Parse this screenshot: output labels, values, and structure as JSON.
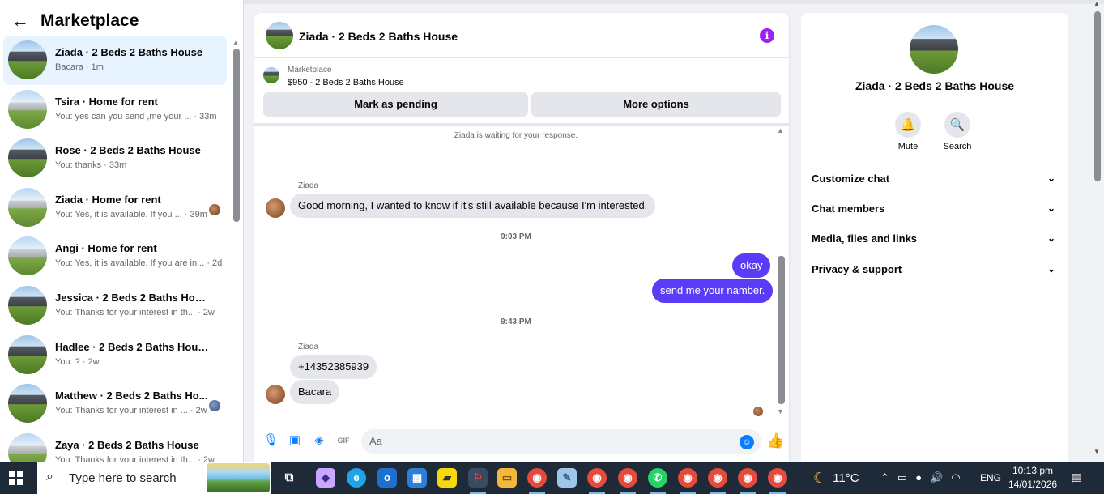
{
  "sidebar": {
    "title": "Marketplace",
    "conversations": [
      {
        "name": "Ziada · 2 Beds 2 Baths House",
        "snippet": "Bacara · 1m"
      },
      {
        "name": "Tsira · Home for rent",
        "snippet": "You: yes can you send ,me your ... · 33m"
      },
      {
        "name": "Rose · 2 Beds 2 Baths House",
        "snippet": "You: thanks · 33m"
      },
      {
        "name": "Ziada · Home for rent",
        "snippet": "You: Yes, it is available. If you ... · 39m"
      },
      {
        "name": "Angi · Home for rent",
        "snippet": "You: Yes, it is available. If you are in... · 2d"
      },
      {
        "name": "Jessica · 2 Beds 2 Baths House",
        "snippet": "You: Thanks for your interest in th... · 2w"
      },
      {
        "name": "Hadlee · 2 Beds 2 Baths House",
        "snippet": "You: ? · 2w"
      },
      {
        "name": "Matthew · 2 Beds 2 Baths Ho...",
        "snippet": "You: Thanks for your interest in ... · 2w"
      },
      {
        "name": "Zaya · 2 Beds 2 Baths House",
        "snippet": "You: Thanks for your interest in th... · 2w"
      }
    ]
  },
  "chat": {
    "title": "Ziada · 2 Beds 2 Baths House",
    "marketplace_label": "Marketplace",
    "listing": "$950 - 2 Beds 2 Baths House",
    "mark_pending": "Mark as pending",
    "more_options": "More options",
    "waiting": "Ziada is waiting for your response.",
    "sender1": "Ziada",
    "msg1": "Good morning, I wanted to know if it's still available because I'm interested.",
    "time1": "9:03 PM",
    "out1": "okay",
    "out2": "send me your namber.",
    "time2": "9:43 PM",
    "sender2": "Ziada",
    "msg2": "+14352385939",
    "msg3": "Bacara",
    "input_placeholder": "Aa"
  },
  "panel": {
    "title": "Ziada · 2 Beds 2 Baths House",
    "mute": "Mute",
    "search": "Search",
    "sections": [
      "Customize chat",
      "Chat members",
      "Media, files and links",
      "Privacy & support"
    ]
  },
  "taskbar": {
    "search_placeholder": "Type here to search",
    "temperature": "11°C",
    "language": "ENG",
    "time": "10:13 pm",
    "date": "14/01/2026"
  },
  "colors": {
    "accent": "#5b3bf5",
    "messenger_blue": "#0a7cff",
    "info_purple": "#a020f0"
  }
}
